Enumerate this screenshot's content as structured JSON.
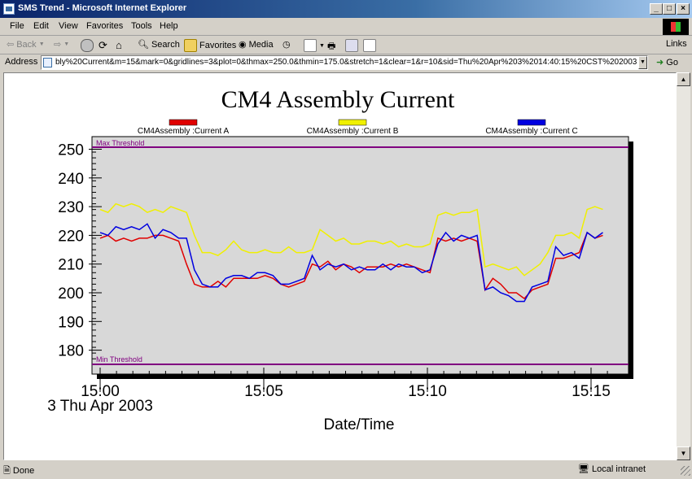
{
  "window": {
    "title": "SMS Trend - Microsoft Internet Explorer"
  },
  "menu": [
    "File",
    "Edit",
    "View",
    "Favorites",
    "Tools",
    "Help"
  ],
  "toolbar": {
    "back": "Back",
    "search": "Search",
    "favorites": "Favorites",
    "media": "Media",
    "links": "Links"
  },
  "address": {
    "label": "Address",
    "url": "bly%20Current&m=15&mark=0&gridlines=3&plot=0&thmax=250.0&thmin=175.0&stretch=1&clear=1&r=10&sid=Thu%20Apr%203%2014:40:15%20CST%202003",
    "go": "Go"
  },
  "status": {
    "text": "Done",
    "zone": "Local intranet"
  },
  "colors": {
    "series_a": "#e00000",
    "series_b": "#f0f000",
    "series_c": "#0000e0",
    "threshold": "#800080",
    "plot_bg": "#d8d8d8"
  },
  "chart_data": {
    "type": "line",
    "title": "CM4 Assembly Current",
    "xlabel": "Date/Time",
    "date_label": "3 Thu Apr 2003",
    "x_ticks": [
      "15:00",
      "15:05",
      "15:10",
      "15:15"
    ],
    "y_ticks": [
      180,
      190,
      200,
      210,
      220,
      230,
      240,
      250
    ],
    "ylim": [
      175,
      250
    ],
    "thresholds": [
      {
        "label": "Max Threshold",
        "value": 250
      },
      {
        "label": "Min Threshold",
        "value": 175
      }
    ],
    "legend_position": "top",
    "x_minutes": [
      0.0,
      0.24,
      0.48,
      0.72,
      0.96,
      1.2,
      1.44,
      1.68,
      1.92,
      2.16,
      2.4,
      2.64,
      2.88,
      3.12,
      3.36,
      3.6,
      3.84,
      4.08,
      4.32,
      4.56,
      4.8,
      5.04,
      5.28,
      5.52,
      5.76,
      6.0,
      6.24,
      6.48,
      6.72,
      6.96,
      7.2,
      7.44,
      7.68,
      7.92,
      8.16,
      8.4,
      8.64,
      8.88,
      9.12,
      9.36,
      9.6,
      9.84,
      10.08,
      10.32,
      10.56,
      10.8,
      11.04,
      11.28,
      11.52,
      11.76,
      12.0,
      12.24,
      12.48,
      12.72,
      12.96,
      13.2,
      13.44,
      13.68,
      13.92,
      14.16,
      14.4,
      14.64,
      14.88,
      15.12,
      15.36
    ],
    "series": [
      {
        "name": "CM4Assembly :Current A",
        "values": [
          219,
          220,
          218,
          219,
          218,
          219,
          219,
          220,
          220,
          219,
          218,
          210,
          203,
          202,
          202,
          204,
          202,
          205,
          205,
          205,
          205,
          206,
          205,
          203,
          202,
          203,
          204,
          210,
          209,
          211,
          208,
          210,
          209,
          207,
          209,
          209,
          209,
          210,
          209,
          210,
          209,
          208,
          207,
          219,
          218,
          219,
          218,
          219,
          218,
          201,
          205,
          203,
          200,
          200,
          198,
          201,
          202,
          203,
          212,
          212,
          213,
          214,
          221,
          219,
          220,
          219,
          221,
          222,
          223
        ]
      },
      {
        "name": "CM4Assembly :Current B",
        "values": [
          229,
          228,
          231,
          230,
          231,
          230,
          228,
          229,
          228,
          230,
          229,
          228,
          220,
          214,
          214,
          213,
          215,
          218,
          215,
          214,
          214,
          215,
          214,
          214,
          216,
          214,
          214,
          215,
          222,
          220,
          218,
          219,
          217,
          217,
          218,
          218,
          217,
          218,
          216,
          217,
          216,
          216,
          217,
          227,
          228,
          227,
          228,
          228,
          229,
          209,
          210,
          209,
          208,
          209,
          206,
          208,
          210,
          214,
          220,
          220,
          221,
          219,
          229,
          230,
          229,
          230,
          228,
          229,
          230
        ]
      },
      {
        "name": "CM4Assembly :Current C",
        "values": [
          221,
          220,
          223,
          222,
          223,
          222,
          224,
          219,
          222,
          221,
          219,
          219,
          208,
          203,
          202,
          202,
          205,
          206,
          206,
          205,
          207,
          207,
          206,
          203,
          203,
          204,
          205,
          213,
          208,
          210,
          209,
          210,
          208,
          209,
          208,
          208,
          210,
          208,
          210,
          209,
          209,
          207,
          208,
          217,
          221,
          218,
          220,
          219,
          220,
          201,
          202,
          200,
          199,
          197,
          197,
          202,
          203,
          204,
          216,
          213,
          214,
          212,
          221,
          219,
          221,
          223,
          220,
          222,
          222
        ]
      }
    ]
  }
}
